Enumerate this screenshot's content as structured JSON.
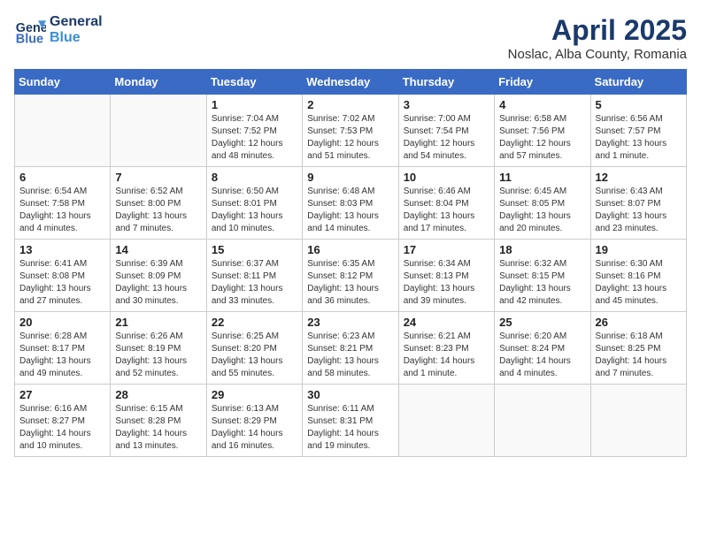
{
  "header": {
    "logo_line1": "General",
    "logo_line2": "Blue",
    "month": "April 2025",
    "location": "Noslac, Alba County, Romania"
  },
  "weekdays": [
    "Sunday",
    "Monday",
    "Tuesday",
    "Wednesday",
    "Thursday",
    "Friday",
    "Saturday"
  ],
  "weeks": [
    [
      {
        "day": "",
        "info": ""
      },
      {
        "day": "",
        "info": ""
      },
      {
        "day": "1",
        "info": "Sunrise: 7:04 AM\nSunset: 7:52 PM\nDaylight: 12 hours and 48 minutes."
      },
      {
        "day": "2",
        "info": "Sunrise: 7:02 AM\nSunset: 7:53 PM\nDaylight: 12 hours and 51 minutes."
      },
      {
        "day": "3",
        "info": "Sunrise: 7:00 AM\nSunset: 7:54 PM\nDaylight: 12 hours and 54 minutes."
      },
      {
        "day": "4",
        "info": "Sunrise: 6:58 AM\nSunset: 7:56 PM\nDaylight: 12 hours and 57 minutes."
      },
      {
        "day": "5",
        "info": "Sunrise: 6:56 AM\nSunset: 7:57 PM\nDaylight: 13 hours and 1 minute."
      }
    ],
    [
      {
        "day": "6",
        "info": "Sunrise: 6:54 AM\nSunset: 7:58 PM\nDaylight: 13 hours and 4 minutes."
      },
      {
        "day": "7",
        "info": "Sunrise: 6:52 AM\nSunset: 8:00 PM\nDaylight: 13 hours and 7 minutes."
      },
      {
        "day": "8",
        "info": "Sunrise: 6:50 AM\nSunset: 8:01 PM\nDaylight: 13 hours and 10 minutes."
      },
      {
        "day": "9",
        "info": "Sunrise: 6:48 AM\nSunset: 8:03 PM\nDaylight: 13 hours and 14 minutes."
      },
      {
        "day": "10",
        "info": "Sunrise: 6:46 AM\nSunset: 8:04 PM\nDaylight: 13 hours and 17 minutes."
      },
      {
        "day": "11",
        "info": "Sunrise: 6:45 AM\nSunset: 8:05 PM\nDaylight: 13 hours and 20 minutes."
      },
      {
        "day": "12",
        "info": "Sunrise: 6:43 AM\nSunset: 8:07 PM\nDaylight: 13 hours and 23 minutes."
      }
    ],
    [
      {
        "day": "13",
        "info": "Sunrise: 6:41 AM\nSunset: 8:08 PM\nDaylight: 13 hours and 27 minutes."
      },
      {
        "day": "14",
        "info": "Sunrise: 6:39 AM\nSunset: 8:09 PM\nDaylight: 13 hours and 30 minutes."
      },
      {
        "day": "15",
        "info": "Sunrise: 6:37 AM\nSunset: 8:11 PM\nDaylight: 13 hours and 33 minutes."
      },
      {
        "day": "16",
        "info": "Sunrise: 6:35 AM\nSunset: 8:12 PM\nDaylight: 13 hours and 36 minutes."
      },
      {
        "day": "17",
        "info": "Sunrise: 6:34 AM\nSunset: 8:13 PM\nDaylight: 13 hours and 39 minutes."
      },
      {
        "day": "18",
        "info": "Sunrise: 6:32 AM\nSunset: 8:15 PM\nDaylight: 13 hours and 42 minutes."
      },
      {
        "day": "19",
        "info": "Sunrise: 6:30 AM\nSunset: 8:16 PM\nDaylight: 13 hours and 45 minutes."
      }
    ],
    [
      {
        "day": "20",
        "info": "Sunrise: 6:28 AM\nSunset: 8:17 PM\nDaylight: 13 hours and 49 minutes."
      },
      {
        "day": "21",
        "info": "Sunrise: 6:26 AM\nSunset: 8:19 PM\nDaylight: 13 hours and 52 minutes."
      },
      {
        "day": "22",
        "info": "Sunrise: 6:25 AM\nSunset: 8:20 PM\nDaylight: 13 hours and 55 minutes."
      },
      {
        "day": "23",
        "info": "Sunrise: 6:23 AM\nSunset: 8:21 PM\nDaylight: 13 hours and 58 minutes."
      },
      {
        "day": "24",
        "info": "Sunrise: 6:21 AM\nSunset: 8:23 PM\nDaylight: 14 hours and 1 minute."
      },
      {
        "day": "25",
        "info": "Sunrise: 6:20 AM\nSunset: 8:24 PM\nDaylight: 14 hours and 4 minutes."
      },
      {
        "day": "26",
        "info": "Sunrise: 6:18 AM\nSunset: 8:25 PM\nDaylight: 14 hours and 7 minutes."
      }
    ],
    [
      {
        "day": "27",
        "info": "Sunrise: 6:16 AM\nSunset: 8:27 PM\nDaylight: 14 hours and 10 minutes."
      },
      {
        "day": "28",
        "info": "Sunrise: 6:15 AM\nSunset: 8:28 PM\nDaylight: 14 hours and 13 minutes."
      },
      {
        "day": "29",
        "info": "Sunrise: 6:13 AM\nSunset: 8:29 PM\nDaylight: 14 hours and 16 minutes."
      },
      {
        "day": "30",
        "info": "Sunrise: 6:11 AM\nSunset: 8:31 PM\nDaylight: 14 hours and 19 minutes."
      },
      {
        "day": "",
        "info": ""
      },
      {
        "day": "",
        "info": ""
      },
      {
        "day": "",
        "info": ""
      }
    ]
  ]
}
